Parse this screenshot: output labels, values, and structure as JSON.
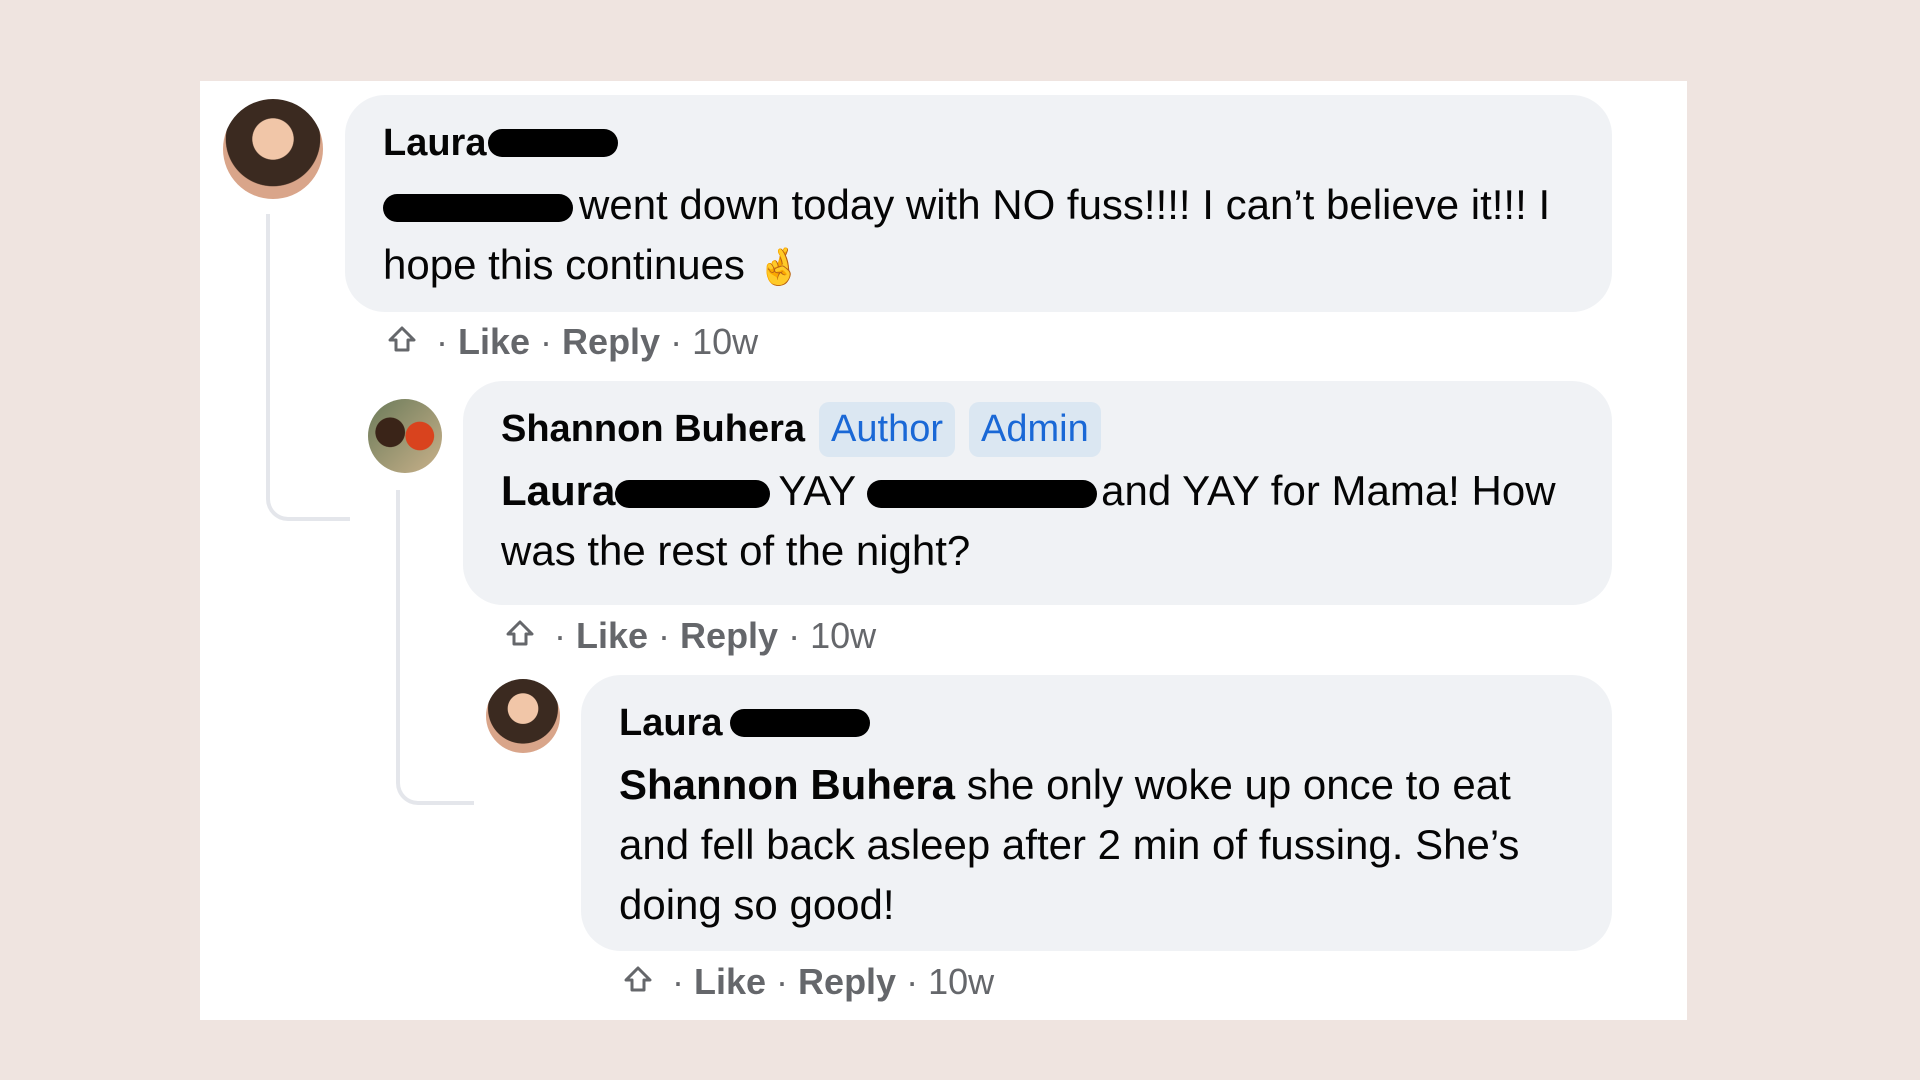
{
  "comments": [
    {
      "author": "Laura",
      "text": "went down today with NO fuss!!!! I can’t believe it!!! I hope this continues",
      "emoji": "🤞",
      "actions": {
        "like": "Like",
        "reply": "Reply",
        "time": "10w"
      }
    },
    {
      "author": "Shannon Buhera",
      "badges": [
        "Author",
        "Admin"
      ],
      "mention": "Laura",
      "text_part1": "YAY",
      "text_part2": "and YAY for Mama! How was the rest of the night?",
      "actions": {
        "like": "Like",
        "reply": "Reply",
        "time": "10w"
      }
    },
    {
      "author": "Laura",
      "mention": "Shannon Buhera",
      "text": "she only woke up once to eat and fell back asleep after 2 min of fussing. She’s doing so good!",
      "actions": {
        "like": "Like",
        "reply": "Reply",
        "time": "10w"
      }
    }
  ],
  "separator": "·",
  "colors": {
    "bubble": "#f0f2f5",
    "badge_bg": "#dbe7f2",
    "badge_text": "#1a68d6",
    "meta": "#65676b",
    "background": "#efe4e0"
  }
}
